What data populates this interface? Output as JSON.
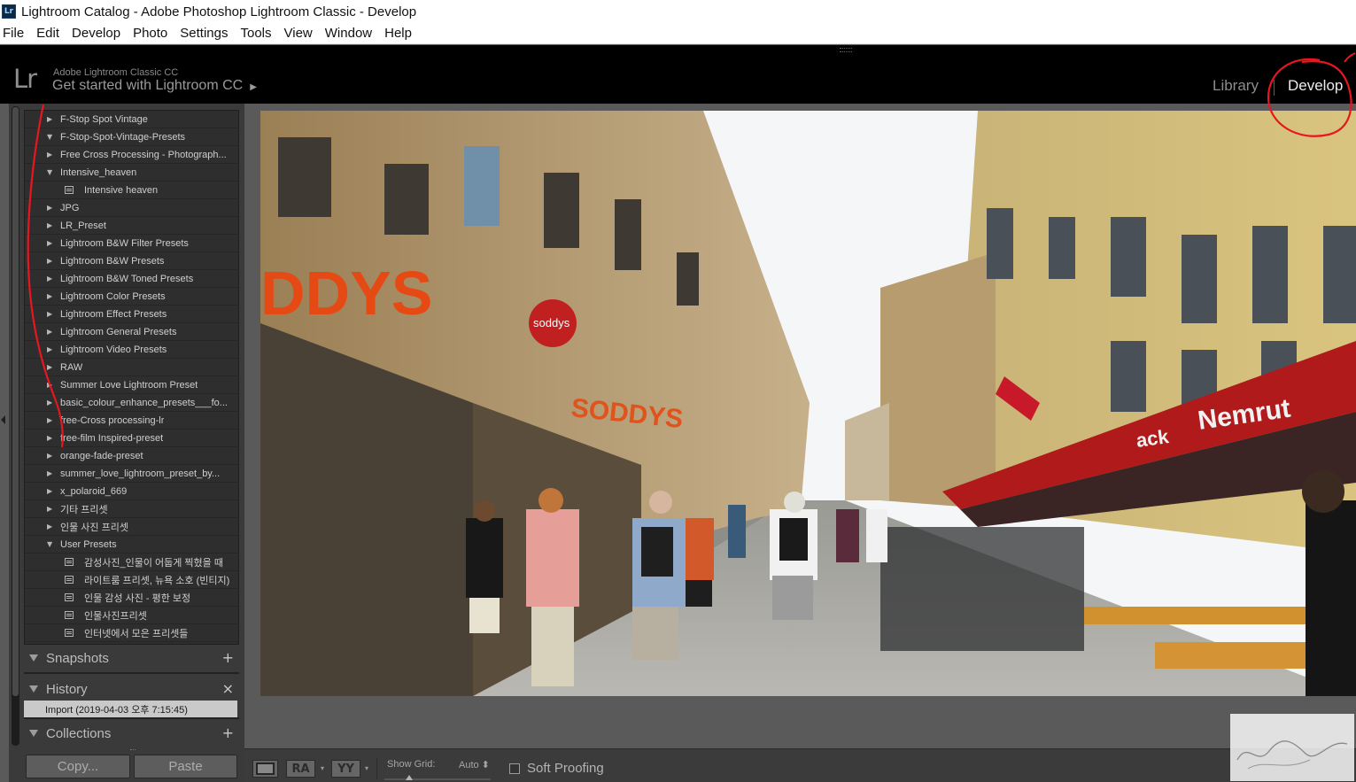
{
  "window": {
    "title": "Lightroom Catalog - Adobe Photoshop Lightroom Classic - Develop",
    "app_icon_text": "Lr"
  },
  "menu": [
    "File",
    "Edit",
    "Develop",
    "Photo",
    "Settings",
    "Tools",
    "View",
    "Window",
    "Help"
  ],
  "identity": {
    "logo": "Lr",
    "product": "Adobe Lightroom Classic CC",
    "cta": "Get started with Lightroom CC",
    "cta_arrow": "▶"
  },
  "modules": {
    "library": "Library",
    "develop": "Develop",
    "active": "Develop"
  },
  "presets": [
    {
      "label": "F-Stop Spot Vintage",
      "type": "folder",
      "expanded": false
    },
    {
      "label": "F-Stop-Spot-Vintage-Presets",
      "type": "folder",
      "expanded": true
    },
    {
      "label": "Free Cross Processing - Photograph...",
      "type": "folder",
      "expanded": false
    },
    {
      "label": "Intensive_heaven",
      "type": "folder",
      "expanded": true
    },
    {
      "label": "Intensive heaven",
      "type": "preset"
    },
    {
      "label": "JPG",
      "type": "folder",
      "expanded": false
    },
    {
      "label": "LR_Preset",
      "type": "folder",
      "expanded": false
    },
    {
      "label": "Lightroom B&W Filter Presets",
      "type": "folder",
      "expanded": false
    },
    {
      "label": "Lightroom B&W Presets",
      "type": "folder",
      "expanded": false
    },
    {
      "label": "Lightroom B&W Toned Presets",
      "type": "folder",
      "expanded": false
    },
    {
      "label": "Lightroom Color Presets",
      "type": "folder",
      "expanded": false
    },
    {
      "label": "Lightroom Effect Presets",
      "type": "folder",
      "expanded": false
    },
    {
      "label": "Lightroom General Presets",
      "type": "folder",
      "expanded": false
    },
    {
      "label": "Lightroom Video Presets",
      "type": "folder",
      "expanded": false
    },
    {
      "label": "RAW",
      "type": "folder",
      "expanded": false
    },
    {
      "label": "Summer Love Lightroom Preset",
      "type": "folder",
      "expanded": false
    },
    {
      "label": "basic_colour_enhance_presets___fo...",
      "type": "folder",
      "expanded": false
    },
    {
      "label": "free-Cross processing-lr",
      "type": "folder",
      "expanded": false
    },
    {
      "label": "free-film Inspired-preset",
      "type": "folder",
      "expanded": false
    },
    {
      "label": "orange-fade-preset",
      "type": "folder",
      "expanded": false
    },
    {
      "label": "summer_love_lightroom_preset_by...",
      "type": "folder",
      "expanded": false
    },
    {
      "label": "x_polaroid_669",
      "type": "folder",
      "expanded": false
    },
    {
      "label": "기타 프리셋",
      "type": "folder",
      "expanded": false
    },
    {
      "label": "인물 사진 프리셋",
      "type": "folder",
      "expanded": false
    },
    {
      "label": "User Presets",
      "type": "folder",
      "expanded": true
    },
    {
      "label": "감성사진_인물이 어둡게 찍혔을 때",
      "type": "preset"
    },
    {
      "label": "라이트룸 프리셋, 뉴욕 소호 (빈티지)",
      "type": "preset"
    },
    {
      "label": "인물 감성 사진 - 평한 보정",
      "type": "preset"
    },
    {
      "label": "인물사진프리셋",
      "type": "preset"
    },
    {
      "label": "인터넷에서 모은 프리셋들",
      "type": "preset"
    }
  ],
  "panels": {
    "snapshots": {
      "label": "Snapshots",
      "action": "+"
    },
    "history": {
      "label": "History",
      "action": "×",
      "items": [
        "Import (2019-04-03 오후 7:15:45)"
      ]
    },
    "collections": {
      "label": "Collections",
      "action": "+"
    }
  },
  "buttons": {
    "copy": "Copy...",
    "paste": "Paste"
  },
  "toolbar": {
    "ra_label": "RA",
    "yy_label": "YY",
    "dropdown_glyph": "▾",
    "show_grid_label": "Show Grid:",
    "show_grid_value": "Auto ⬍",
    "soft_proofing_label": "Soft Proofing",
    "soft_proofing_checked": false
  },
  "photo": {
    "subject": "street scene with pedestrians",
    "signs": [
      "DDYS",
      "soddys",
      "SODDYS",
      "Nemrut",
      "ack"
    ]
  },
  "colors": {
    "chrome": "#000000",
    "panel": "#3a3a3a",
    "active_module": "#ececec",
    "annotation_red": "#e8161f"
  }
}
